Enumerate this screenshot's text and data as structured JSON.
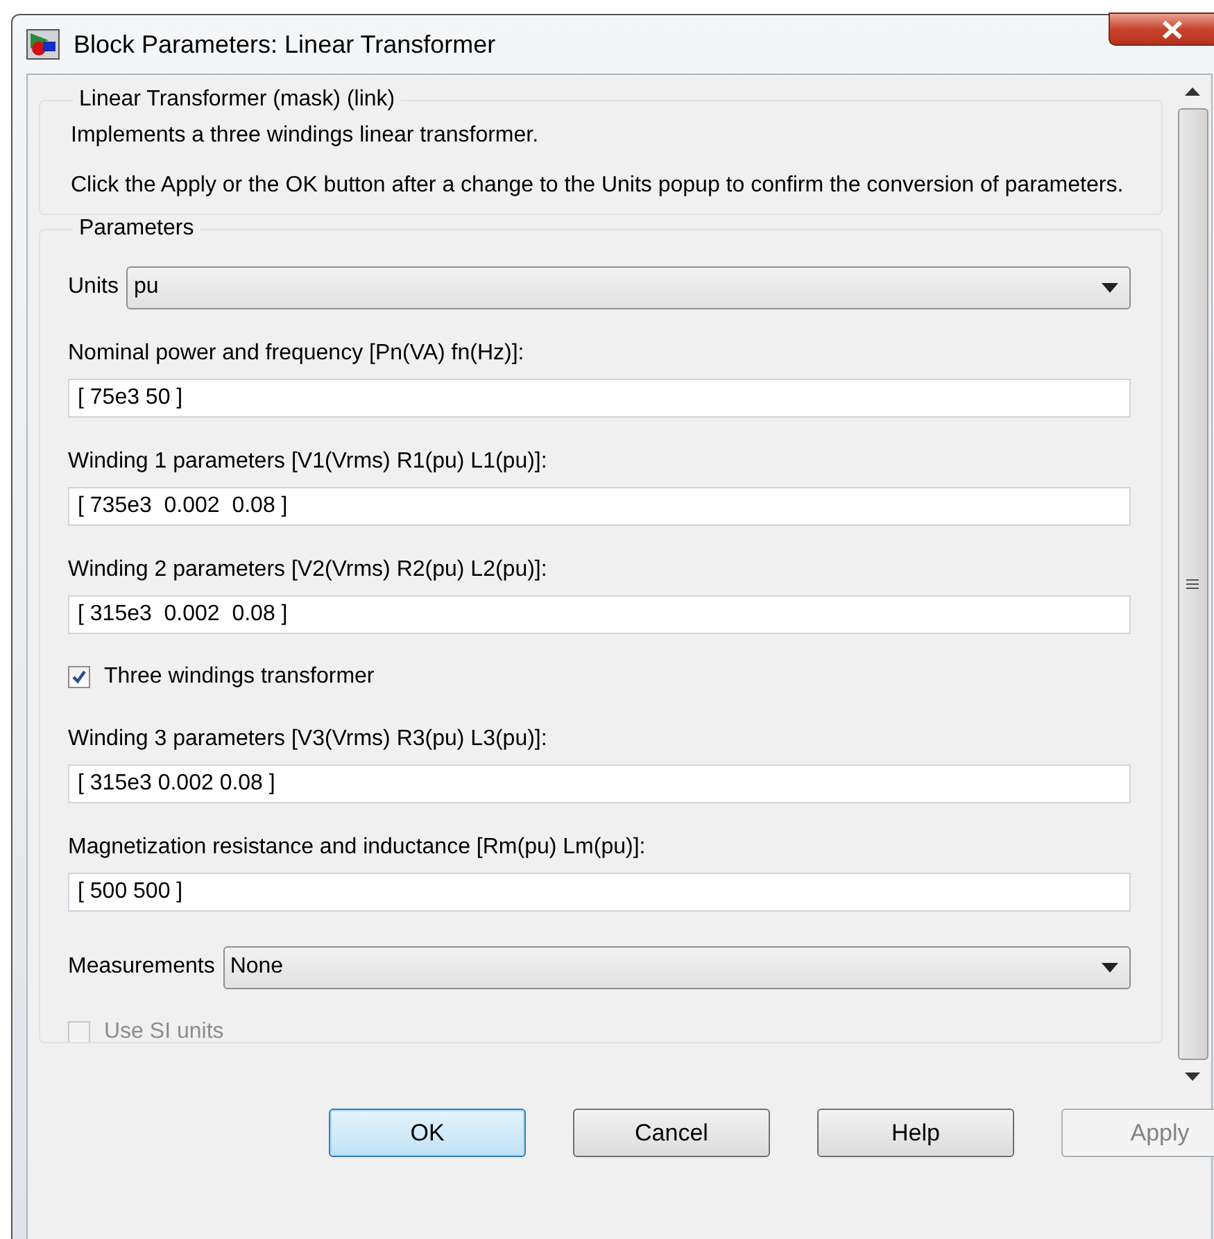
{
  "window": {
    "title": "Block Parameters: Linear Transformer"
  },
  "description": {
    "legend": "Linear Transformer (mask) (link)",
    "paragraphs": [
      "Implements a three windings linear transformer.",
      "Click the Apply or the OK button after a change to the Units popup to confirm the conversion of parameters."
    ]
  },
  "parameters": {
    "legend": "Parameters",
    "items": [
      {
        "kind": "select",
        "label": "Units",
        "value": "pu"
      },
      {
        "kind": "field",
        "label": "Nominal power and frequency [Pn(VA) fn(Hz)]:",
        "value": "[ 75e3 50 ]"
      },
      {
        "kind": "field",
        "label": "Winding 1 parameters [V1(Vrms) R1(pu) L1(pu)]:",
        "value": "[ 735e3  0.002  0.08 ]"
      },
      {
        "kind": "field",
        "label": "Winding 2 parameters [V2(Vrms) R2(pu) L2(pu)]:",
        "value": "[ 315e3  0.002  0.08 ]"
      },
      {
        "kind": "checkbox",
        "label": "Three windings transformer",
        "checked": true,
        "disabled": false
      },
      {
        "kind": "field",
        "label": "Winding 3 parameters [V3(Vrms) R3(pu) L3(pu)]:",
        "value": "[ 315e3 0.002 0.08 ]"
      },
      {
        "kind": "field",
        "label": "Magnetization resistance and inductance [Rm(pu) Lm(pu)]:",
        "value": "[ 500 500 ]"
      },
      {
        "kind": "select",
        "label": "Measurements",
        "value": "None"
      },
      {
        "kind": "checkbox",
        "label": "Use SI units",
        "checked": false,
        "disabled": true
      }
    ]
  },
  "buttons": [
    {
      "label": "OK",
      "default": true,
      "disabled": false
    },
    {
      "label": "Cancel",
      "default": false,
      "disabled": false
    },
    {
      "label": "Help",
      "default": false,
      "disabled": false
    },
    {
      "label": "Apply",
      "default": false,
      "disabled": true
    }
  ]
}
